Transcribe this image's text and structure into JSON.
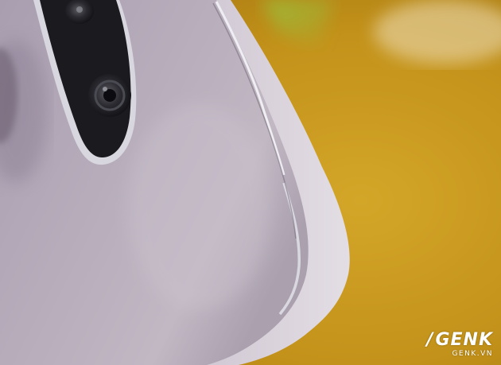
{
  "scene": {
    "subject": "phone-back-closeup",
    "colors": {
      "background_yellow": "#c99a1e",
      "background_green": "#8fb23a",
      "phone_body": "#b3a9b8",
      "phone_edge": "#d9d2da",
      "camera_housing": "#1b1b1f",
      "chrome_rim": "#e8e8ee"
    }
  },
  "watermark": {
    "logo_text": "GENK",
    "slash": "/",
    "site": "GENK.VN"
  }
}
